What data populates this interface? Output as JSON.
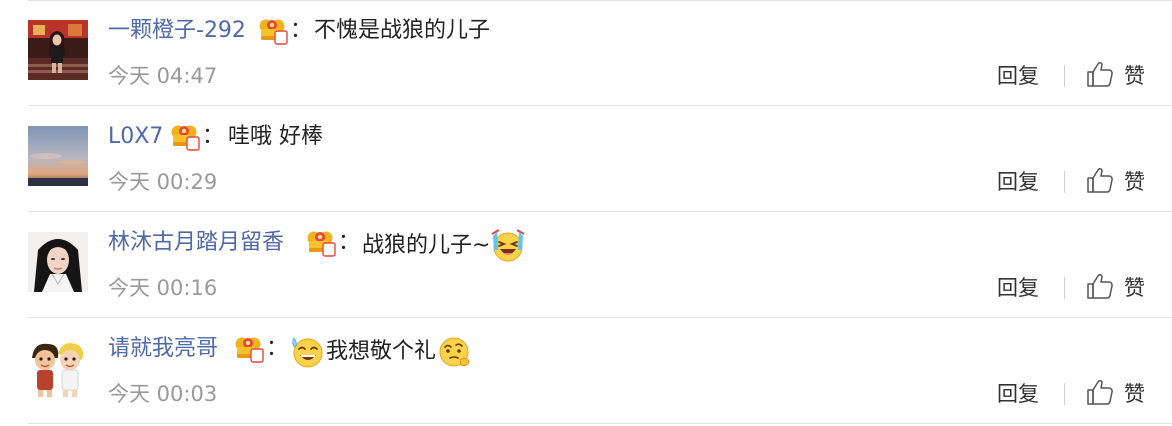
{
  "comments": [
    {
      "username": "一颗橙子-292",
      "badge_level": "2",
      "content_text": "不愧是战狼的儿子",
      "timestamp": "今天 04:47",
      "reply_label": "回复",
      "like_label": "赞"
    },
    {
      "username": "L0X7",
      "badge_level": "1",
      "content_text": "哇哦 好棒",
      "timestamp": "今天 00:29",
      "reply_label": "回复",
      "like_label": "赞"
    },
    {
      "username": "林沐古月踏月留香",
      "badge_level": "5",
      "content_text": "战狼的儿子~",
      "timestamp": "今天 00:16",
      "reply_label": "回复",
      "like_label": "赞",
      "trailing_emoji": "laughing-tears-emoji"
    },
    {
      "username": "请就我亮哥",
      "badge_level": "1",
      "content_text": "我想敬个礼",
      "timestamp": "今天 00:03",
      "reply_label": "回复",
      "like_label": "赞",
      "leading_emoji": "sweat-smile-emoji",
      "trailing_emoji": "thinking-emoji"
    }
  ],
  "colon": "：",
  "colors": {
    "username": "#4f69a6",
    "text": "#222222",
    "timestamp": "#999999",
    "separator": "#e3e3e3",
    "badge_gold": "#f5b51f",
    "badge_red": "#e5463d"
  }
}
